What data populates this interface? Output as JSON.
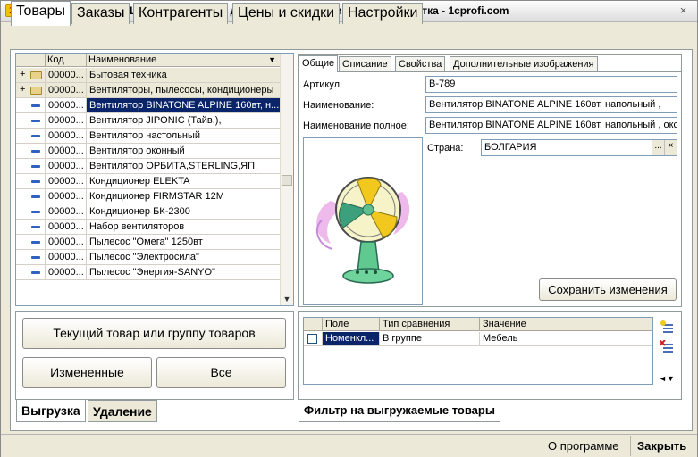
{
  "window": {
    "title": "Модуль интеграции1С и web-магазина для чайников. Версия 1.01. Разработка - 1cprofi.com",
    "close_glyph": "×"
  },
  "main_tabs": [
    {
      "label": "Товары",
      "active": true
    },
    {
      "label": "Заказы"
    },
    {
      "label": "Контрагенты"
    },
    {
      "label": "Цены и скидки"
    },
    {
      "label": "Настройки"
    }
  ],
  "product_list": {
    "columns": {
      "code": "Код",
      "name": "Наименование"
    },
    "rows": [
      {
        "type": "group",
        "code": "00000...",
        "name": "Бытовая техника"
      },
      {
        "type": "group",
        "code": "00000...",
        "name": "Вентиляторы, пылесосы, кондиционеры"
      },
      {
        "type": "item",
        "code": "00000...",
        "name": "Вентилятор BINATONE ALPINE 160вт, н...",
        "selected": true
      },
      {
        "type": "item",
        "code": "00000...",
        "name": "Вентилятор JIPONIC (Тайв.),"
      },
      {
        "type": "item",
        "code": "00000...",
        "name": "Вентилятор настольный"
      },
      {
        "type": "item",
        "code": "00000...",
        "name": "Вентилятор оконный"
      },
      {
        "type": "item",
        "code": "00000...",
        "name": "Вентилятор ОРБИТА,STERLING,ЯП."
      },
      {
        "type": "item",
        "code": "00000...",
        "name": "Кондиционер ELEKTA"
      },
      {
        "type": "item",
        "code": "00000...",
        "name": "Кондиционер FIRMSTAR 12M"
      },
      {
        "type": "item",
        "code": "00000...",
        "name": "Кондиционер БК-2300"
      },
      {
        "type": "item",
        "code": "00000...",
        "name": "Набор вентиляторов"
      },
      {
        "type": "item",
        "code": "00000...",
        "name": "Пылесос \"Омега\" 1250вт"
      },
      {
        "type": "item",
        "code": "00000...",
        "name": "Пылесос \"Электросила\""
      },
      {
        "type": "item",
        "code": "00000...",
        "name": "Пылесос \"Энергия-SANYO\""
      }
    ]
  },
  "detail_tabs": [
    {
      "label": "Общие",
      "active": true
    },
    {
      "label": "Описание"
    },
    {
      "label": "Свойства"
    },
    {
      "label": "Дополнительные изображения"
    }
  ],
  "detail": {
    "article_label": "Артикул:",
    "article_value": "В-789",
    "name_label": "Наименование:",
    "name_value": "Вентилятор BINATONE ALPINE 160вт, напольный ,",
    "fullname_label": "Наименование полное:",
    "fullname_value": "Вентилятор BINATONE ALPINE 160вт, напольный , окс",
    "country_label": "Страна:",
    "country_value": "БОЛГАРИЯ",
    "pick_glyph": "...",
    "clear_glyph": "×",
    "save_button": "Сохранить изменения"
  },
  "export_panel": {
    "current_button": "Текущий товар или группу товаров",
    "changed_button": "Измененные",
    "all_button": "Все",
    "tabs": [
      {
        "label": "Выгрузка",
        "active": true
      },
      {
        "label": "Удаление"
      }
    ]
  },
  "filter": {
    "columns": {
      "field": "Поле",
      "compare": "Тип сравнения",
      "value": "Значение"
    },
    "rows": [
      {
        "field": "Номенкл...",
        "compare": "В группе",
        "value": "Мебель"
      }
    ],
    "tab_label": "Фильтр на выгружаемые товары"
  },
  "statusbar": {
    "about": "О программе",
    "close": "Закрыть"
  },
  "colors": {
    "selection": "#0a246a",
    "window_bg": "#ece9d8",
    "border": "#919b9c"
  }
}
